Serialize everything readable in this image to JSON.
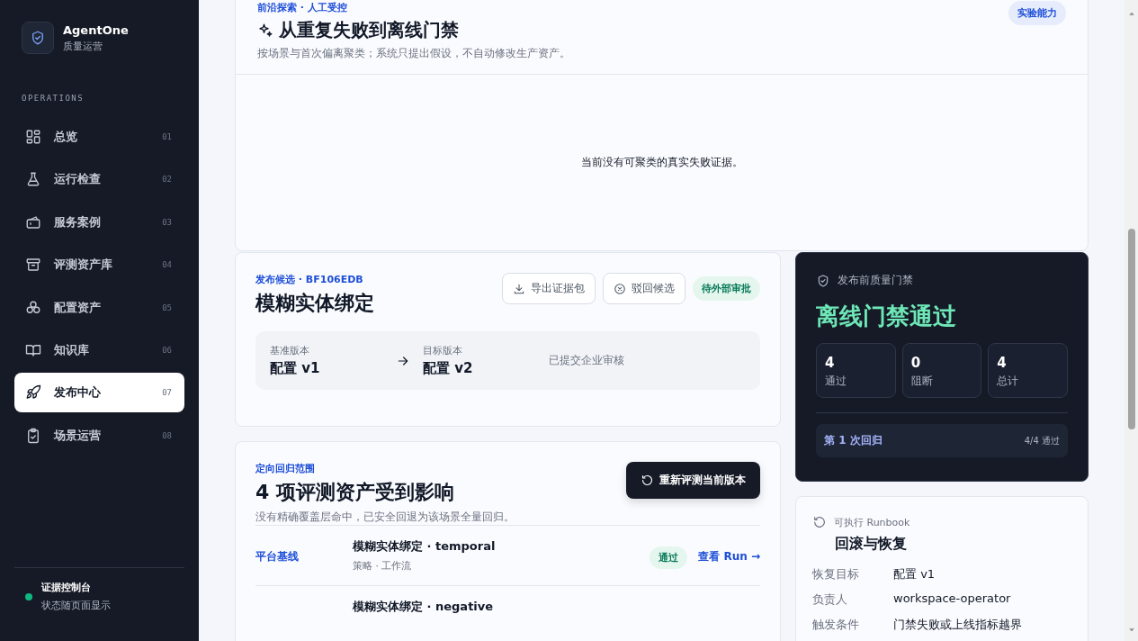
{
  "brand": {
    "name": "AgentOne",
    "subtitle": "质量运营"
  },
  "nav_section": "OPERATIONS",
  "nav": [
    {
      "label": "总览",
      "index": "01",
      "selected": false
    },
    {
      "label": "运行检查",
      "index": "02",
      "selected": false
    },
    {
      "label": "服务案例",
      "index": "03",
      "selected": false
    },
    {
      "label": "评测资产库",
      "index": "04",
      "selected": false
    },
    {
      "label": "配置资产",
      "index": "05",
      "selected": false
    },
    {
      "label": "知识库",
      "index": "06",
      "selected": false
    },
    {
      "label": "发布中心",
      "index": "07",
      "selected": true
    },
    {
      "label": "场景运营",
      "index": "08",
      "selected": false
    }
  ],
  "footer": {
    "title": "证据控制台",
    "subtitle": "状态随页面显示",
    "color": "#10b981"
  },
  "exploration": {
    "eyebrow": "前沿探索 · 人工受控",
    "title": "从重复失败到离线门禁",
    "description": "按场景与首次偏离聚类；系统只提出假设，不自动修改生产资产。",
    "badge": "实验能力",
    "empty_message": "当前没有可聚类的真实失败证据。"
  },
  "candidate": {
    "eyebrow": "发布候选 · BF106EDB",
    "title": "模糊实体绑定",
    "buttons": [
      {
        "label": "导出证据包"
      },
      {
        "label": "驳回候选"
      }
    ],
    "status": "待外部审批",
    "base_label": "基准版本",
    "base_value": "配置 v1",
    "target_label": "目标版本",
    "target_value": "配置 v2",
    "note": "已提交企业审核"
  },
  "gate": {
    "label": "发布前质量门禁",
    "title": "离线门禁通过",
    "stats": [
      {
        "value": "4",
        "label": "通过"
      },
      {
        "value": "0",
        "label": "阻断"
      },
      {
        "value": "4",
        "label": "总计"
      }
    ],
    "round": "第 1 次回归",
    "round_result": "4/4 通过"
  },
  "regression": {
    "eyebrow": "定向回归范围",
    "title": "4 项评测资产受到影响",
    "description": "没有精确覆盖层命中，已安全回退为该场景全量回归。",
    "action": "重新评测当前版本",
    "rows": [
      {
        "group": "平台基线",
        "title": "模糊实体绑定 · temporal",
        "meta": "策略 · 工作流",
        "status": "通过",
        "link": "查看 Run →"
      },
      {
        "title": "模糊实体绑定 · negative"
      }
    ]
  },
  "runbook": {
    "eyebrow": "可执行 Runbook",
    "title": "回滚与恢复",
    "fields": [
      {
        "label": "恢复目标",
        "value": "配置 v1"
      },
      {
        "label": "负责人",
        "value": "workspace-operator"
      },
      {
        "label": "触发条件",
        "value": "门禁失败或上线指标越界"
      }
    ]
  }
}
